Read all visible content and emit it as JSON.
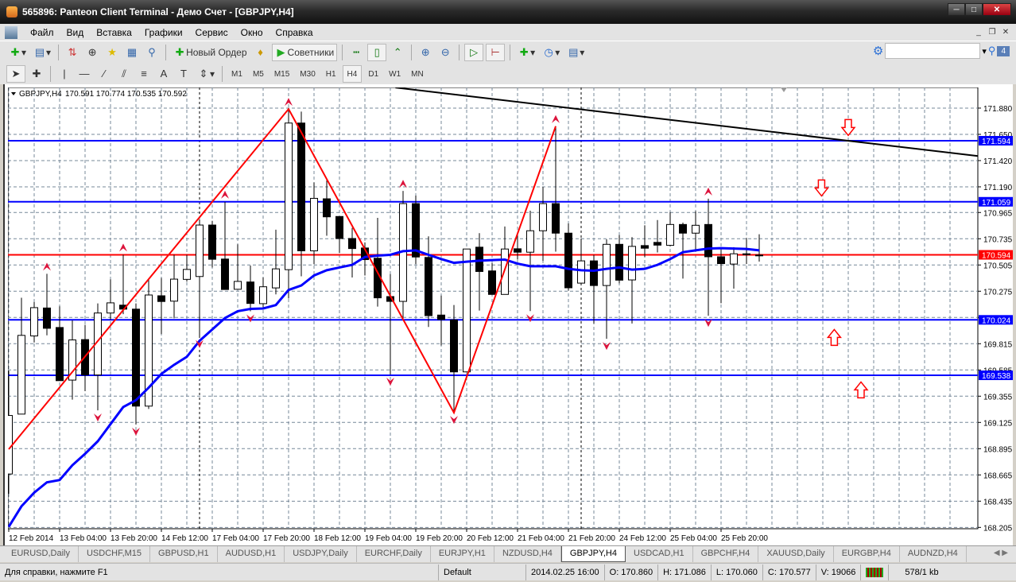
{
  "window": {
    "title": "565896: Panteon Client Terminal - Демо Счет - [GBPJPY,H4]"
  },
  "menu": [
    "Файл",
    "Вид",
    "Вставка",
    "Графики",
    "Сервис",
    "Окно",
    "Справка"
  ],
  "toolbar": {
    "new_order": "Новый Ордер",
    "experts": "Советники",
    "search_badge": "4",
    "search_placeholder": ""
  },
  "timeframes": [
    "M1",
    "M5",
    "M15",
    "M30",
    "H1",
    "H4",
    "D1",
    "W1",
    "MN"
  ],
  "active_timeframe": "H4",
  "chart_header": {
    "symbol": "GBPJPY,H4",
    "values": "170.591 170.774 170.535 170.592"
  },
  "colors": {
    "bull_fill": "#ffffff",
    "bear_fill": "#000000",
    "ma": "#0000ff",
    "levels": "#0000ff",
    "bid": "#ff0000",
    "zigzag": "#ff0000",
    "fractal": "#dc143c",
    "trendline": "#000000"
  },
  "chart_data": {
    "type": "candlestick",
    "symbol": "GBPJPY",
    "timeframe": "H4",
    "ylim": [
      168.205,
      171.95
    ],
    "y_ticks": [
      "171.880",
      "171.650",
      "171.420",
      "171.190",
      "170.965",
      "170.735",
      "170.505",
      "170.275",
      "170.045",
      "169.815",
      "169.585",
      "169.355",
      "169.125",
      "168.895",
      "168.665",
      "168.435",
      "168.205"
    ],
    "x_labels": [
      {
        "i": 0,
        "t": "12 Feb 2014"
      },
      {
        "i": 4,
        "t": "13 Feb 04:00"
      },
      {
        "i": 8,
        "t": "13 Feb 20:00"
      },
      {
        "i": 12,
        "t": "14 Feb 12:00"
      },
      {
        "i": 16,
        "t": "17 Feb 04:00"
      },
      {
        "i": 20,
        "t": "17 Feb 20:00"
      },
      {
        "i": 24,
        "t": "18 Feb 12:00"
      },
      {
        "i": 28,
        "t": "19 Feb 04:00"
      },
      {
        "i": 32,
        "t": "19 Feb 20:00"
      },
      {
        "i": 36,
        "t": "20 Feb 12:00"
      },
      {
        "i": 40,
        "t": "21 Feb 04:00"
      },
      {
        "i": 44,
        "t": "21 Feb 20:00"
      },
      {
        "i": 48,
        "t": "24 Feb 12:00"
      },
      {
        "i": 52,
        "t": "25 Feb 04:00"
      },
      {
        "i": 56,
        "t": "25 Feb 20:00"
      }
    ],
    "day_separators": [
      15,
      45
    ],
    "ohlc": [
      [
        168.673,
        169.578,
        168.5,
        169.186
      ],
      [
        169.198,
        170.218,
        169.198,
        169.888
      ],
      [
        169.883,
        170.18,
        169.826,
        170.131
      ],
      [
        170.128,
        170.428,
        169.888,
        169.95
      ],
      [
        169.957,
        170.143,
        169.491,
        169.491
      ],
      [
        169.496,
        170.019,
        169.325,
        169.848
      ],
      [
        169.851,
        169.98,
        169.399,
        169.541
      ],
      [
        169.541,
        170.168,
        169.231,
        170.084
      ],
      [
        170.084,
        170.379,
        170.024,
        170.173
      ],
      [
        170.153,
        170.595,
        170.074,
        170.118
      ],
      [
        170.118,
        170.168,
        169.107,
        169.268
      ],
      [
        169.268,
        170.384,
        169.243,
        170.242
      ],
      [
        170.235,
        170.391,
        169.9,
        170.185
      ],
      [
        170.188,
        170.595,
        170.037,
        170.381
      ],
      [
        170.379,
        170.595,
        170.359,
        170.466
      ],
      [
        170.404,
        170.905,
        169.875,
        170.855
      ],
      [
        170.855,
        170.892,
        170.483,
        170.555
      ],
      [
        170.557,
        171.058,
        170.29,
        170.29
      ],
      [
        170.292,
        170.686,
        170.292,
        170.361
      ],
      [
        170.356,
        170.5,
        170.099,
        170.168
      ],
      [
        170.166,
        170.395,
        170.135,
        170.314
      ],
      [
        170.304,
        170.814,
        170.247,
        170.471
      ],
      [
        170.464,
        171.872,
        170.212,
        171.749
      ],
      [
        171.749,
        171.849,
        170.406,
        170.629
      ],
      [
        170.629,
        171.228,
        170.511,
        171.089
      ],
      [
        171.085,
        171.247,
        170.761,
        170.927
      ],
      [
        170.93,
        170.93,
        170.61,
        170.737
      ],
      [
        170.737,
        170.83,
        170.395,
        170.649
      ],
      [
        170.654,
        170.703,
        170.413,
        170.552
      ],
      [
        170.564,
        170.918,
        170.14,
        170.217
      ],
      [
        170.228,
        170.425,
        169.545,
        170.186
      ],
      [
        170.186,
        171.154,
        170.043,
        171.043
      ],
      [
        171.043,
        171.113,
        170.511,
        170.575
      ],
      [
        170.571,
        170.756,
        169.962,
        170.061
      ],
      [
        170.066,
        170.237,
        169.8,
        170.027
      ],
      [
        170.024,
        170.154,
        169.21,
        169.568
      ],
      [
        169.568,
        170.645,
        169.568,
        170.645
      ],
      [
        170.661,
        170.784,
        170.105,
        170.448
      ],
      [
        170.453,
        170.522,
        170.247,
        170.247
      ],
      [
        170.247,
        170.842,
        170.247,
        170.645
      ],
      [
        170.647,
        170.772,
        170.552,
        170.617
      ],
      [
        170.617,
        170.981,
        170.101,
        170.805
      ],
      [
        170.805,
        171.189,
        170.541,
        171.043
      ],
      [
        171.043,
        171.721,
        170.622,
        170.784
      ],
      [
        170.784,
        170.869,
        170.281,
        170.305
      ],
      [
        170.346,
        170.737,
        170.346,
        170.541
      ],
      [
        170.541,
        170.594,
        169.992,
        170.325
      ],
      [
        170.325,
        170.73,
        169.858,
        170.686
      ],
      [
        170.686,
        170.767,
        170.344,
        170.372
      ],
      [
        170.374,
        170.749,
        169.992,
        170.668
      ],
      [
        170.675,
        170.853,
        170.575,
        170.652
      ],
      [
        170.703,
        170.899,
        170.615,
        170.679
      ],
      [
        170.677,
        170.969,
        170.668,
        170.86
      ],
      [
        170.86,
        170.876,
        170.386,
        170.784
      ],
      [
        170.784,
        170.976,
        170.622,
        170.853
      ],
      [
        170.86,
        171.086,
        170.06,
        170.577
      ],
      [
        170.577,
        170.64,
        170.17,
        170.517
      ],
      [
        170.513,
        170.661,
        170.298,
        170.603
      ],
      [
        170.603,
        170.742,
        170.513,
        170.598
      ],
      [
        170.591,
        170.774,
        170.535,
        170.592
      ]
    ],
    "moving_average": [
      168.21,
      168.39,
      168.51,
      168.6,
      168.62,
      168.75,
      168.85,
      168.96,
      169.11,
      169.26,
      169.32,
      169.43,
      169.55,
      169.63,
      169.7,
      169.84,
      169.94,
      170.04,
      170.1,
      170.12,
      170.124,
      170.154,
      170.286,
      170.325,
      170.413,
      170.459,
      170.483,
      170.506,
      170.575,
      170.587,
      170.594,
      170.626,
      170.633,
      170.594,
      170.557,
      170.524,
      170.534,
      170.543,
      170.548,
      170.552,
      170.517,
      170.494,
      170.494,
      170.494,
      170.471,
      170.459,
      170.455,
      170.471,
      170.483,
      170.464,
      170.471,
      170.506,
      170.557,
      170.617,
      170.633,
      170.649,
      170.652,
      170.649,
      170.645,
      170.633
    ],
    "zigzag": [
      {
        "i": 0,
        "p": 168.89
      },
      {
        "i": 22,
        "p": 171.872
      },
      {
        "i": 35,
        "p": 169.21
      },
      {
        "i": 43,
        "p": 171.721
      }
    ],
    "fractals_up": [
      3,
      9,
      17,
      22,
      31,
      43,
      55
    ],
    "fractals_down": [
      7,
      10,
      15,
      19,
      30,
      35,
      41,
      47,
      55
    ],
    "trendline": [
      {
        "i": 30.4,
        "p": 172.06
      },
      {
        "i": 76.2,
        "p": 171.46
      }
    ],
    "levels": [
      {
        "price": 171.594,
        "label": "171.594",
        "kind": "level"
      },
      {
        "price": 171.059,
        "label": "171.059",
        "kind": "level"
      },
      {
        "price": 170.024,
        "label": "170.024",
        "kind": "level"
      },
      {
        "price": 169.538,
        "label": "169.538",
        "kind": "level"
      },
      {
        "price": 170.594,
        "label": "170.594",
        "kind": "bid"
      }
    ],
    "arrow_objects": [
      {
        "i": 66,
        "p": 171.71,
        "dir": "down"
      },
      {
        "i": 63.9,
        "p": 171.18,
        "dir": "down"
      },
      {
        "i": 64.9,
        "p": 169.87,
        "dir": "up"
      },
      {
        "i": 67,
        "p": 169.41,
        "dir": "up"
      }
    ]
  },
  "tabs": [
    "EURUSD,Daily",
    "USDCHF,M15",
    "GBPUSD,H1",
    "AUDUSD,H1",
    "USDJPY,Daily",
    "EURCHF,Daily",
    "EURJPY,H1",
    "NZDUSD,H4",
    "GBPJPY,H4",
    "USDCAD,H1",
    "GBPCHF,H4",
    "XAUUSD,Daily",
    "EURGBP,H4",
    "AUDNZD,H4"
  ],
  "active_tab": "GBPJPY,H4",
  "status": {
    "help": "Для справки, нажмите F1",
    "profile": "Default",
    "datetime": "2014.02.25 16:00",
    "open": "O: 170.860",
    "high": "H: 171.086",
    "low": "L: 170.060",
    "close": "C: 170.577",
    "volume": "V: 19066",
    "traffic": "578/1 kb"
  }
}
